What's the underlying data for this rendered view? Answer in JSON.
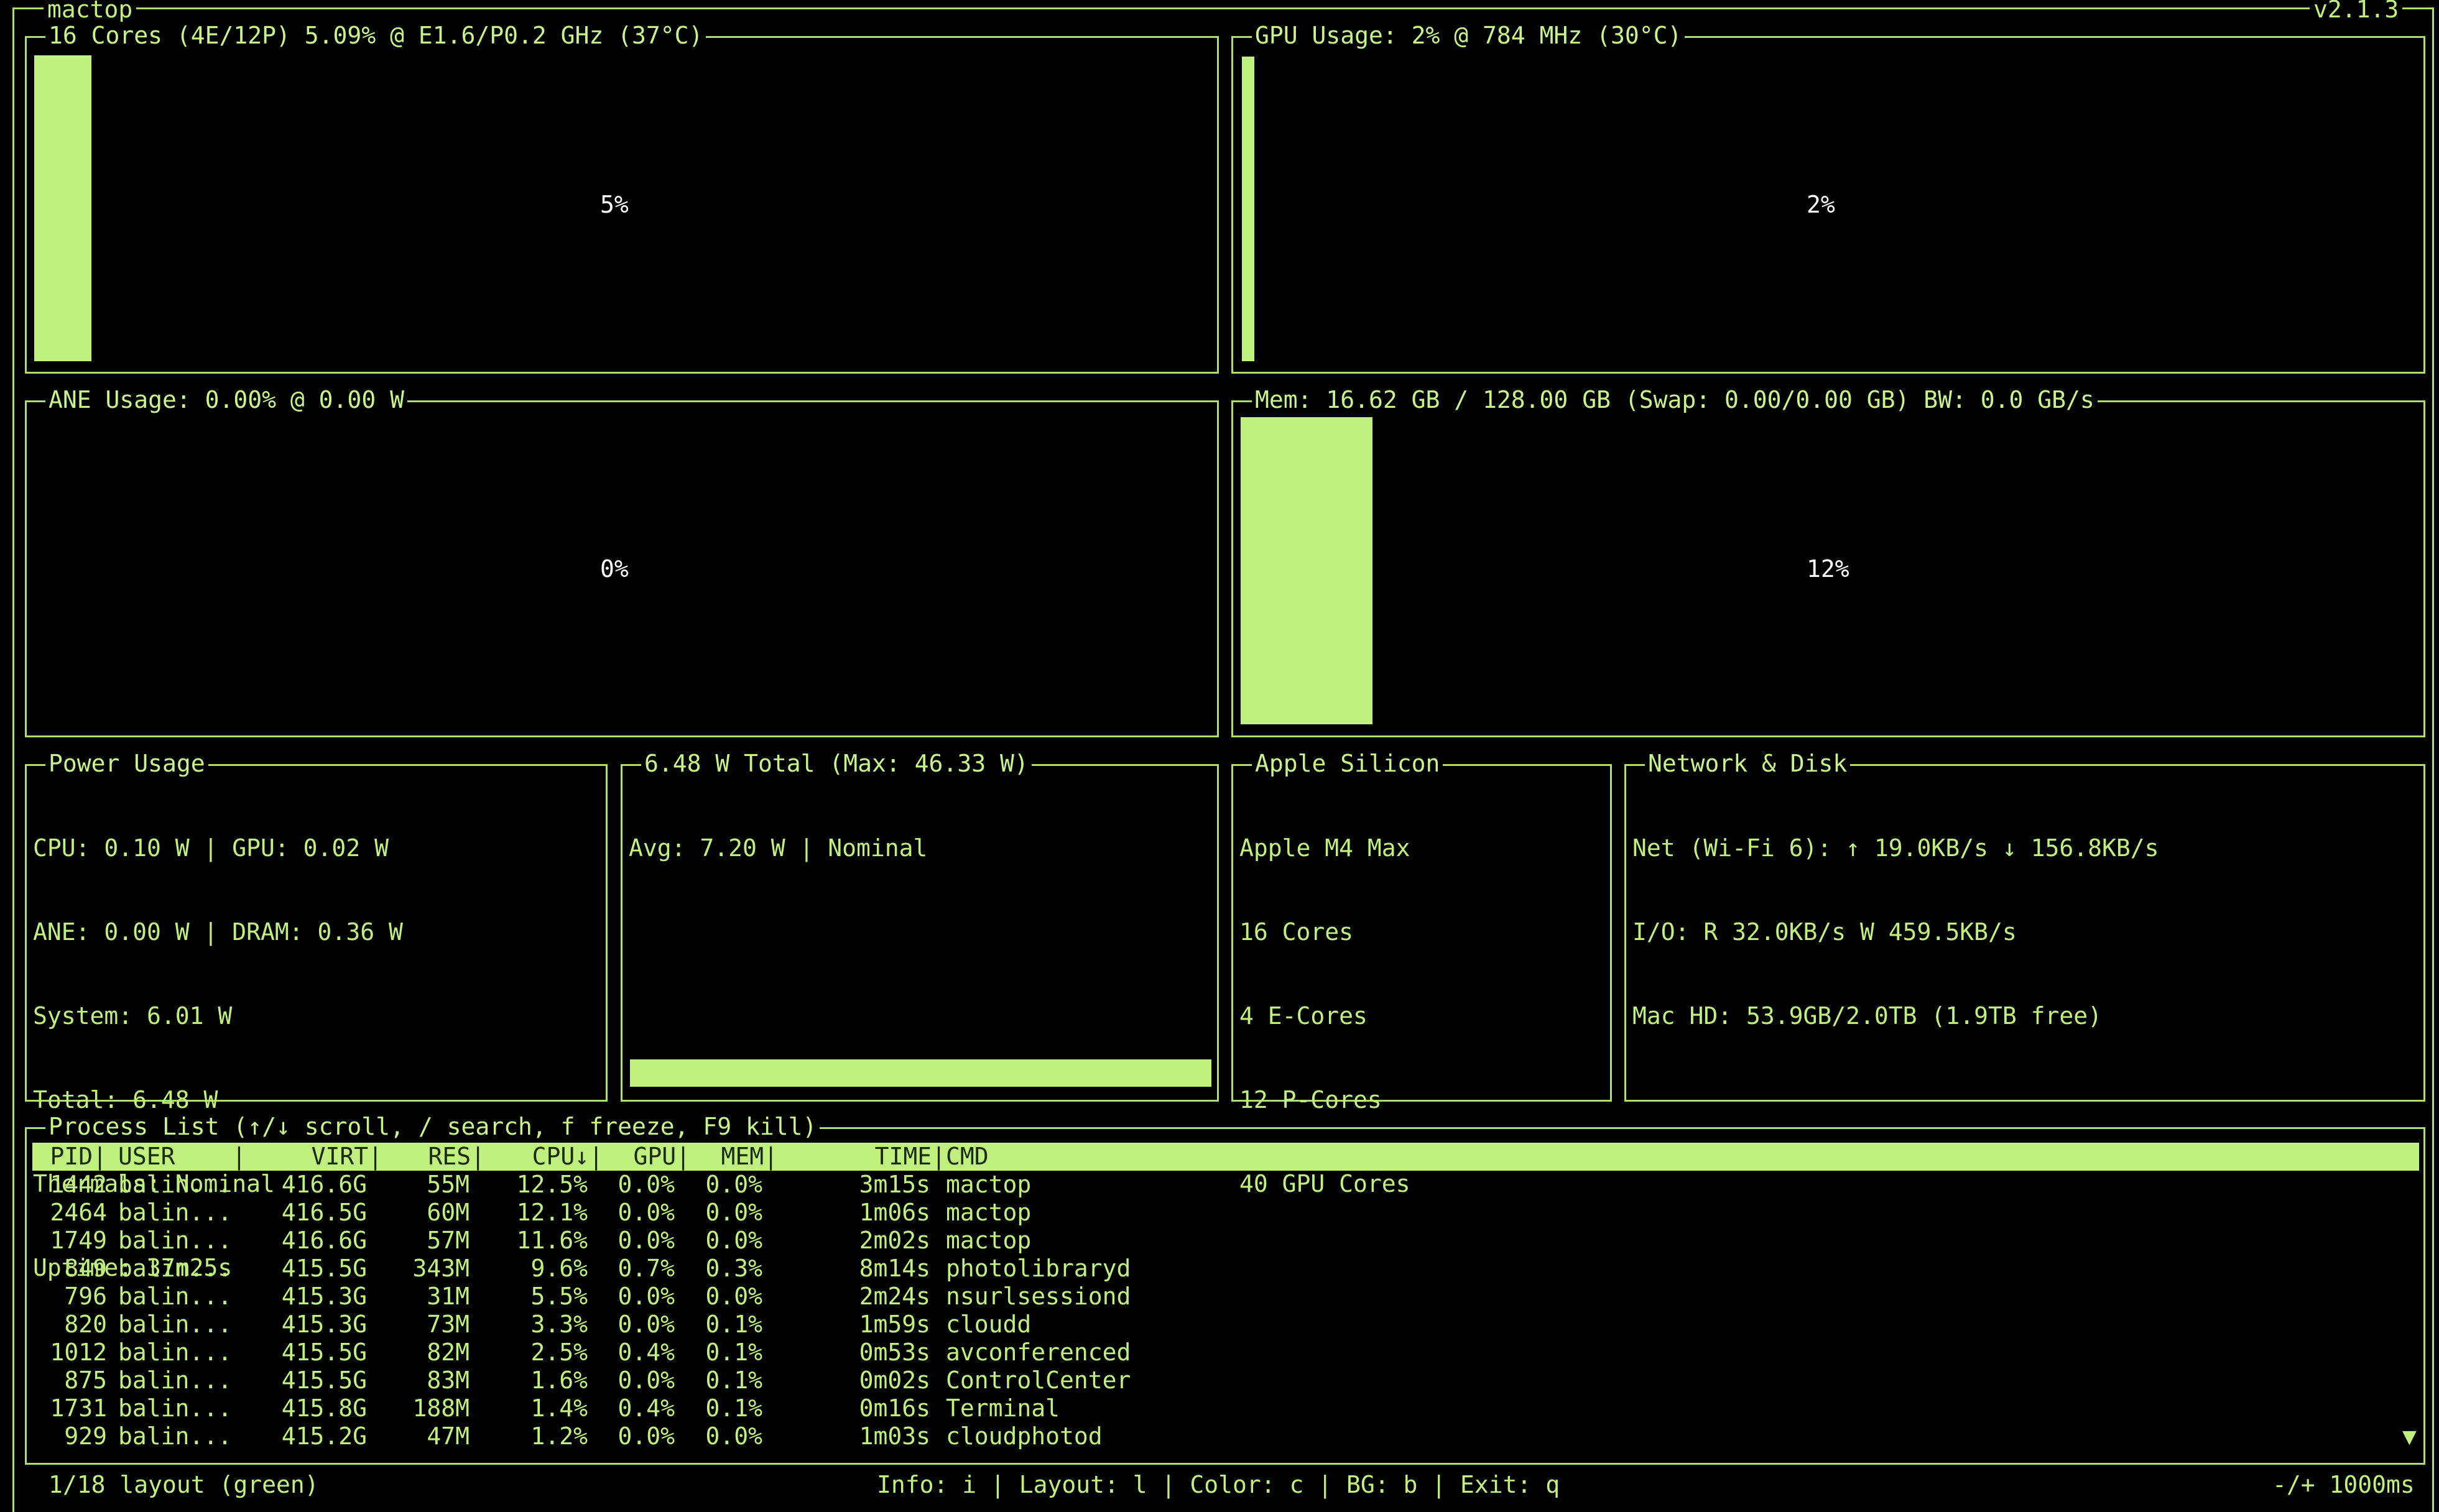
{
  "app": {
    "title": "mactop",
    "version": "v2.1.3"
  },
  "cpu": {
    "title": "16 Cores (4E/12P) 5.09% @ E1.6/P0.2 GHz (37°C)",
    "percent_label": "5%",
    "percent": 5
  },
  "gpu": {
    "title": "GPU Usage: 2% @ 784 MHz (30°C)",
    "percent_label": "2%",
    "percent": 2
  },
  "ane": {
    "title": "ANE Usage: 0.00% @ 0.00 W",
    "percent_label": "0%",
    "percent": 0
  },
  "mem": {
    "title": "Mem: 16.62 GB / 128.00 GB (Swap: 0.00/0.00 GB) BW: 0.0 GB/s",
    "percent_label": "12%",
    "percent": 12
  },
  "power": {
    "title": "Power Usage",
    "lines": [
      "CPU: 0.10 W | GPU: 0.02 W",
      "ANE: 0.00 W | DRAM: 0.36 W",
      "System: 6.01 W",
      "Total: 6.48 W",
      "Thermals: Nominal",
      "Uptime: 37m25s"
    ]
  },
  "total": {
    "title": "6.48 W Total (Max: 46.33 W)",
    "line": "Avg: 7.20 W | Nominal"
  },
  "silicon": {
    "title": "Apple Silicon",
    "lines": [
      "Apple M4 Max",
      "16 Cores",
      "4 E-Cores",
      "12 P-Cores",
      "40 GPU Cores"
    ]
  },
  "network": {
    "title": "Network & Disk",
    "lines": [
      "Net (Wi-Fi 6): ↑ 19.0KB/s ↓ 156.8KB/s",
      "I/O: R 32.0KB/s W 459.5KB/s",
      "Mac HD: 53.9GB/2.0TB (1.9TB free)"
    ]
  },
  "process_list": {
    "title": "Process List (↑/↓ scroll, / search, f freeze, F9 kill)",
    "headers": {
      "pid": "PID|",
      "user": "USER    |",
      "virt": "VIRT|",
      "res": "RES|",
      "cpu": "CPU↓|",
      "gpu": "GPU|",
      "mem": "MEM|",
      "time": "TIME|",
      "cmd": "CMD"
    },
    "rows": [
      {
        "pid": "1442",
        "user": "balin...",
        "virt": "416.6G",
        "res": "55M",
        "cpu": "12.5%",
        "gpu": "0.0%",
        "mem": "0.0%",
        "time": "3m15s",
        "cmd": "mactop"
      },
      {
        "pid": "2464",
        "user": "balin...",
        "virt": "416.5G",
        "res": "60M",
        "cpu": "12.1%",
        "gpu": "0.0%",
        "mem": "0.0%",
        "time": "1m06s",
        "cmd": "mactop"
      },
      {
        "pid": "1749",
        "user": "balin...",
        "virt": "416.6G",
        "res": "57M",
        "cpu": "11.6%",
        "gpu": "0.0%",
        "mem": "0.0%",
        "time": "2m02s",
        "cmd": "mactop"
      },
      {
        "pid": "849",
        "user": "balin...",
        "virt": "415.5G",
        "res": "343M",
        "cpu": "9.6%",
        "gpu": "0.7%",
        "mem": "0.3%",
        "time": "8m14s",
        "cmd": "photolibraryd"
      },
      {
        "pid": "796",
        "user": "balin...",
        "virt": "415.3G",
        "res": "31M",
        "cpu": "5.5%",
        "gpu": "0.0%",
        "mem": "0.0%",
        "time": "2m24s",
        "cmd": "nsurlsessiond"
      },
      {
        "pid": "820",
        "user": "balin...",
        "virt": "415.3G",
        "res": "73M",
        "cpu": "3.3%",
        "gpu": "0.0%",
        "mem": "0.1%",
        "time": "1m59s",
        "cmd": "cloudd"
      },
      {
        "pid": "1012",
        "user": "balin...",
        "virt": "415.5G",
        "res": "82M",
        "cpu": "2.5%",
        "gpu": "0.4%",
        "mem": "0.1%",
        "time": "0m53s",
        "cmd": "avconferenced"
      },
      {
        "pid": "875",
        "user": "balin...",
        "virt": "415.5G",
        "res": "83M",
        "cpu": "1.6%",
        "gpu": "0.0%",
        "mem": "0.1%",
        "time": "0m02s",
        "cmd": "ControlCenter"
      },
      {
        "pid": "1731",
        "user": "balin...",
        "virt": "415.8G",
        "res": "188M",
        "cpu": "1.4%",
        "gpu": "0.4%",
        "mem": "0.1%",
        "time": "0m16s",
        "cmd": "Terminal"
      },
      {
        "pid": "929",
        "user": "balin...",
        "virt": "415.2G",
        "res": "47M",
        "cpu": "1.2%",
        "gpu": "0.0%",
        "mem": "0.0%",
        "time": "1m03s",
        "cmd": "cloudphotod"
      }
    ],
    "scroll_indicator": "▼"
  },
  "status_bar": {
    "left": "1/18 layout (green)",
    "center": "Info: i | Layout: l | Color: c | BG: b | Exit: q",
    "right": "-/+ 1000ms"
  },
  "colors": {
    "accent": "#c0f07e",
    "border": "#aede6d",
    "background": "#000000",
    "percent_text": "#ffffff"
  }
}
